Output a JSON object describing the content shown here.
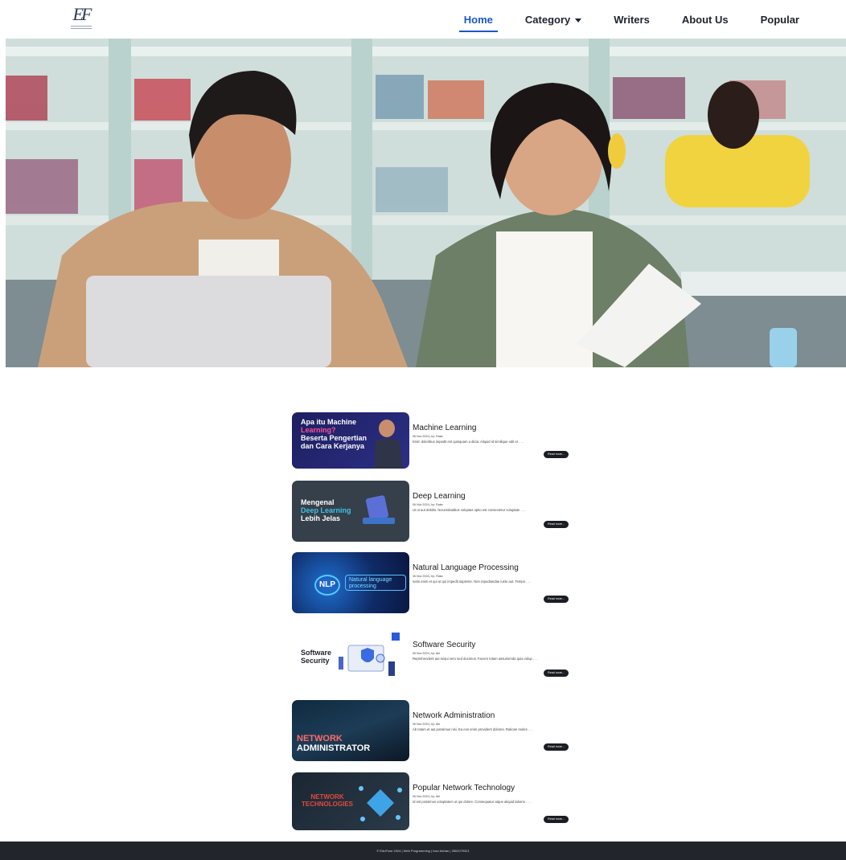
{
  "nav": {
    "logo_text": "EF",
    "items": [
      {
        "label": "Home"
      },
      {
        "label": "Category"
      },
      {
        "label": "Writers"
      },
      {
        "label": "About Us"
      },
      {
        "label": "Popular"
      }
    ]
  },
  "articles": [
    {
      "title": "Machine Learning",
      "meta": "06 Nov 2024 | by: Raka",
      "excerpt": "Enim doloribus impedit est quisquam a dicta. Aliquid id similique odit et . . .",
      "read_more": "Read more...",
      "thumb_lines": [
        "Apa itu Machine",
        "Learning?",
        "Beserta Pengertian",
        "dan Cara Kerjanya"
      ]
    },
    {
      "title": "Deep Learning",
      "meta": "06 Nov 2024 | by: Raka",
      "excerpt": "Ut ut aut debitis. Necessitatibus voluptas optio est consectetur voluptate . . .",
      "read_more": "Read more...",
      "thumb_lines": [
        "Mengenal",
        "Deep Learning",
        "Lebih Jelas"
      ]
    },
    {
      "title": "Natural Language Processing",
      "meta": "06 Nov 2024 | by: Raka",
      "excerpt": "Iusto enim et qui ut qui impedit sapiente. Non repudiandae iusto aut. Tempo . . .",
      "read_more": "Read more...",
      "thumb_lines": [
        "NLP",
        "Natural language",
        "processing"
      ]
    },
    {
      "title": "Software Security",
      "meta": "06 Nov 2024 | by: Abi",
      "excerpt": "Reprehenderit aut sequi vero sed ducimus. Facere totam assumenda quia volup . . .",
      "read_more": "Read more...",
      "thumb_lines": [
        "Software",
        "Security"
      ]
    },
    {
      "title": "Network Administration",
      "meta": "06 Nov 2024 | by: Abi",
      "excerpt": "Ab totam et aut possimus nisi. Ea eos enim provident dolores. Ratione moles . . .",
      "read_more": "Read more...",
      "thumb_lines": [
        "NETWORK",
        "ADMINISTRATOR"
      ]
    },
    {
      "title": "Popular Network Technology",
      "meta": "06 Nov 2024 | by: Abi",
      "excerpt": "Id est possimus voluptatem ut qui dolore. Consequatur atque aliquid laborio . . .",
      "read_more": "Read more...",
      "thumb_lines": [
        "NETWORK",
        "TECHNOLOGIES"
      ]
    }
  ],
  "footer": {
    "text": "© EduFuse 2024 | Web Programming | Ivan Adrian | 2802079321"
  },
  "colors": {
    "nav_active": "#1a56c8",
    "footer_bg": "#22252b",
    "button_bg": "#1b1d22"
  }
}
